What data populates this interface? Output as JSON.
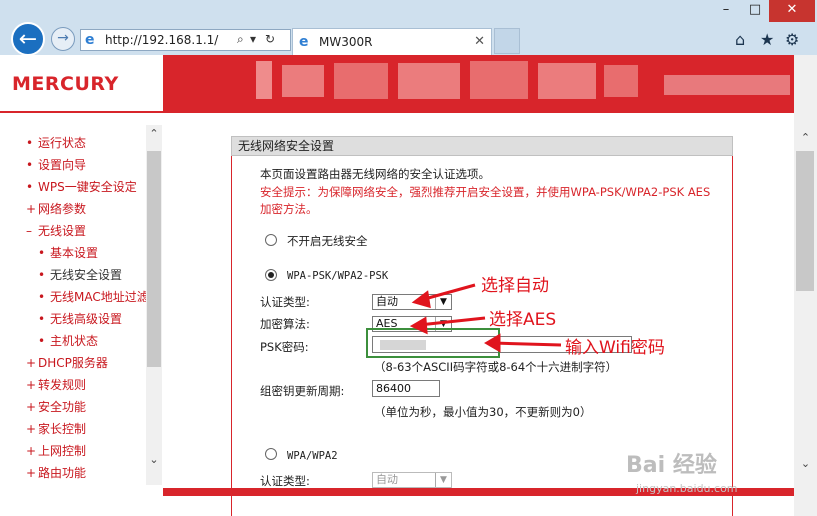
{
  "window": {
    "min": "–",
    "max": "□",
    "close": "✕"
  },
  "browser": {
    "back_glyph": "←",
    "forward_glyph": "→",
    "address": "http://192.168.1.1/",
    "search_glyph": "⌕",
    "dropdown_glyph": "▾",
    "refresh_glyph": "↻",
    "tab_title": "MW300R",
    "tab_close": "✕",
    "home_glyph": "⌂",
    "star_glyph": "★",
    "gear_glyph": "⚙"
  },
  "brand": {
    "logo": "MERCURY",
    "accent": "#d8252b"
  },
  "sidebar": {
    "items": [
      {
        "mark": "•",
        "label": "运行状态"
      },
      {
        "mark": "•",
        "label": "设置向导"
      },
      {
        "mark": "•",
        "label": "WPS一键安全设定"
      },
      {
        "mark": "+",
        "label": "网络参数"
      },
      {
        "mark": "–",
        "label": "无线设置"
      },
      {
        "mark": "•",
        "label": "基本设置"
      },
      {
        "mark": "•",
        "label": "无线安全设置"
      },
      {
        "mark": "•",
        "label": "无线MAC地址过滤"
      },
      {
        "mark": "•",
        "label": "无线高级设置"
      },
      {
        "mark": "•",
        "label": "主机状态"
      },
      {
        "mark": "+",
        "label": "DHCP服务器"
      },
      {
        "mark": "+",
        "label": "转发规则"
      },
      {
        "mark": "+",
        "label": "安全功能"
      },
      {
        "mark": "+",
        "label": "家长控制"
      },
      {
        "mark": "+",
        "label": "上网控制"
      },
      {
        "mark": "+",
        "label": "路由功能"
      }
    ],
    "scroll_up": "⌃",
    "scroll_down": "⌄"
  },
  "main": {
    "panel_title": "无线网络安全设置",
    "intro": "本页面设置路由器无线网络的安全认证选项。",
    "warning_line1": "安全提示：为保障网络安全，强烈推荐开启安全设置，并使用WPA-PSK/WPA2-PSK AES",
    "warning_line2": "加密方法。",
    "opt_none": "不开启无线安全",
    "opt_wpa_psk": "WPA-PSK/WPA2-PSK",
    "auth_label": "认证类型:",
    "auth_value": "自动",
    "enc_label": "加密算法:",
    "enc_value": "AES",
    "psk_label": "PSK密码:",
    "psk_hint": "（8-63个ASCII码字符或8-64个十六进制字符）",
    "renew_label": "组密钥更新周期:",
    "renew_value": "86400",
    "renew_hint": "（单位为秒，最小值为30，不更新则为0）",
    "opt_wpa": "WPA/WPA2",
    "auth2_label": "认证类型:",
    "auth2_value": "自动"
  },
  "annotations": {
    "a1": "选择自动",
    "a2": "选择AES",
    "a3": "输入Wifi密码",
    "color": "#e0141d"
  },
  "watermark": {
    "main": "Bai 经验",
    "sub": "jingyan.baidu.com"
  }
}
